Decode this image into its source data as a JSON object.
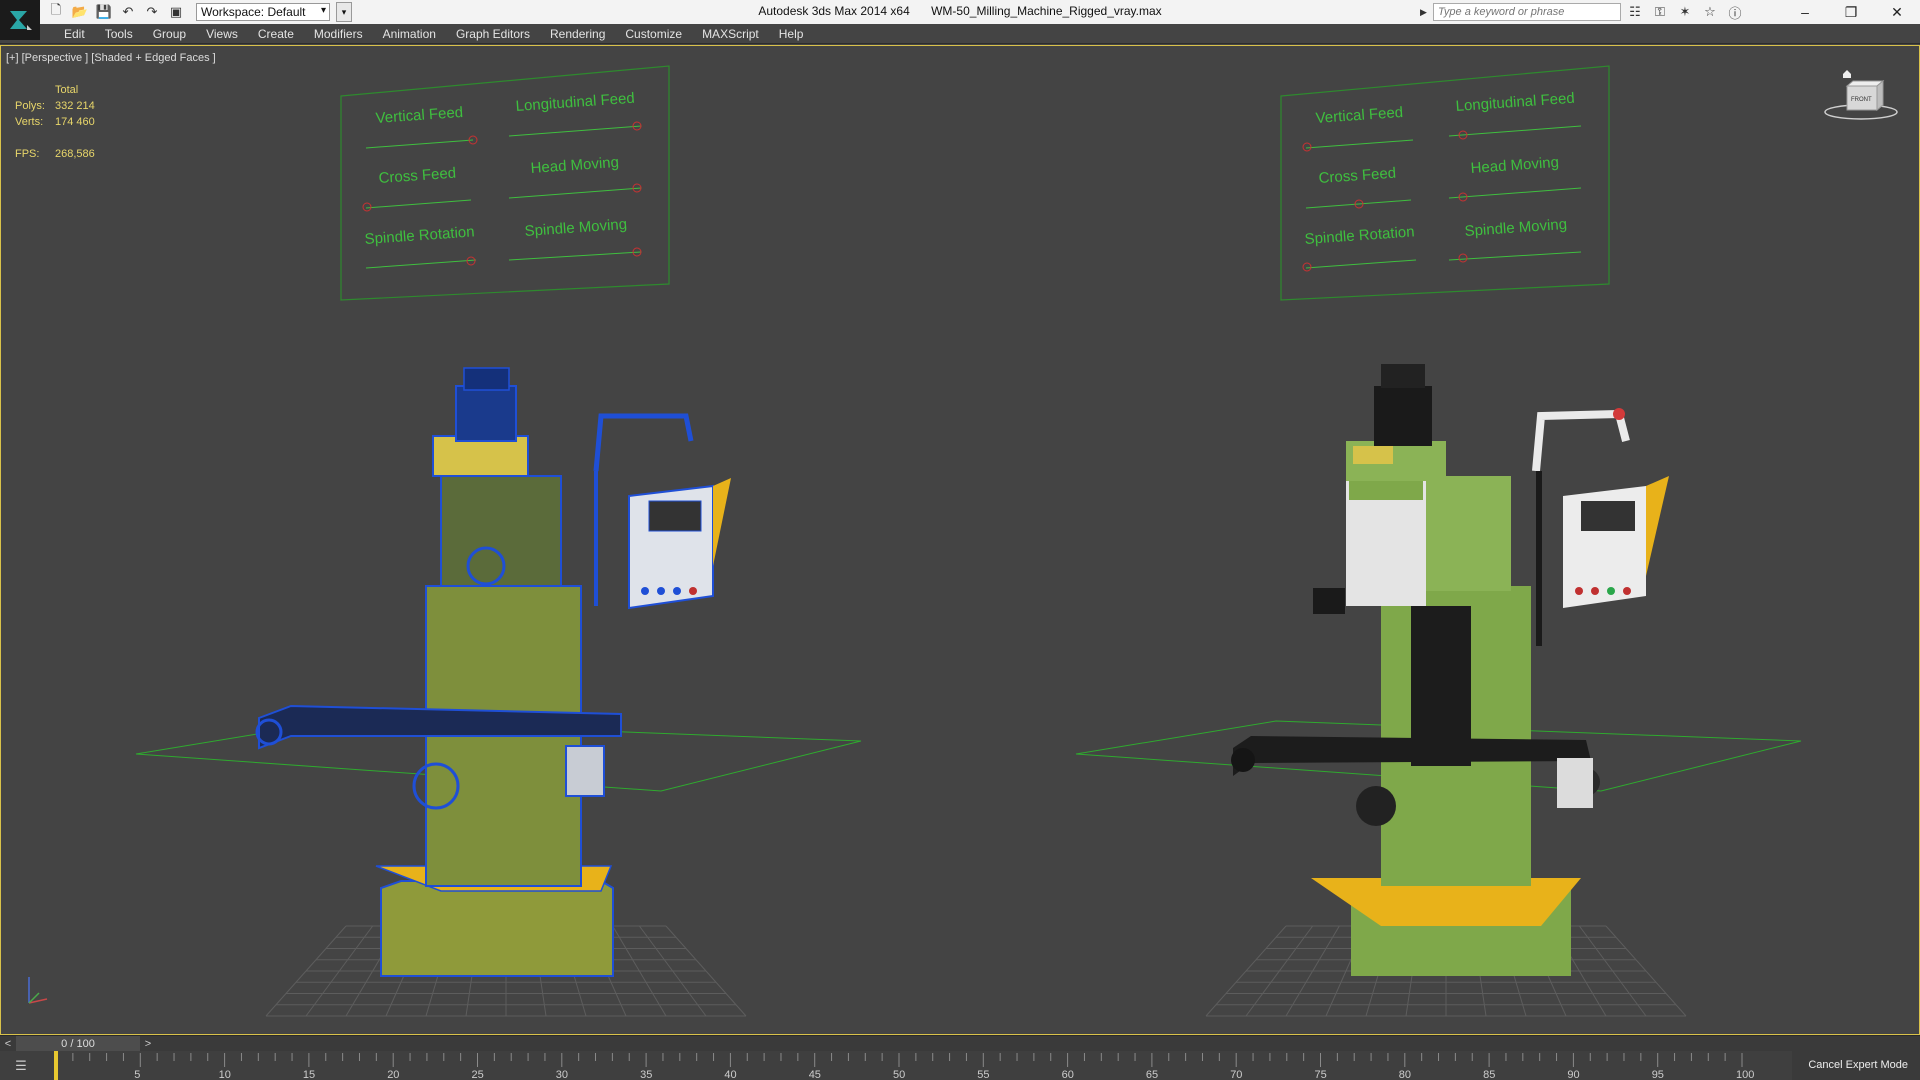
{
  "titlebar": {
    "workspace": "Workspace: Default",
    "app_name": "Autodesk 3ds Max  2014 x64",
    "file_name": "WM-50_Milling_Machine_Rigged_vray.max",
    "search_placeholder": "Type a keyword or phrase"
  },
  "menu": [
    "Edit",
    "Tools",
    "Group",
    "Views",
    "Create",
    "Modifiers",
    "Animation",
    "Graph Editors",
    "Rendering",
    "Customize",
    "MAXScript",
    "Help"
  ],
  "viewport": {
    "label": "[+] [Perspective ] [Shaded + Edged Faces ]",
    "stats": {
      "header": "Total",
      "polys_label": "Polys:",
      "polys_value": "332 214",
      "verts_label": "Verts:",
      "verts_value": "174 460",
      "fps_label": "FPS:",
      "fps_value": "268,586"
    },
    "viewcube_label": "FRONT",
    "control_panel_labels": [
      "Vertical Feed",
      "Longitudinal Feed",
      "Cross Feed",
      "Head Moving",
      "Spindle Rotation",
      "Spindle Moving"
    ]
  },
  "timeline": {
    "frame": "0 / 100",
    "prev": "<",
    "next": ">",
    "ticks": [
      5,
      10,
      15,
      20,
      25,
      30,
      35,
      40,
      45,
      50,
      55,
      60,
      65,
      70,
      75,
      80,
      85,
      90,
      95,
      100
    ],
    "cancel_expert": "Cancel Expert Mode"
  },
  "colors": {
    "accent": "#d9c24a",
    "panel_green": "#3fbf3f",
    "wire_blue": "#1f4fd6",
    "machine_green": "#7fa84a",
    "tray_yellow": "#e8b21a"
  }
}
